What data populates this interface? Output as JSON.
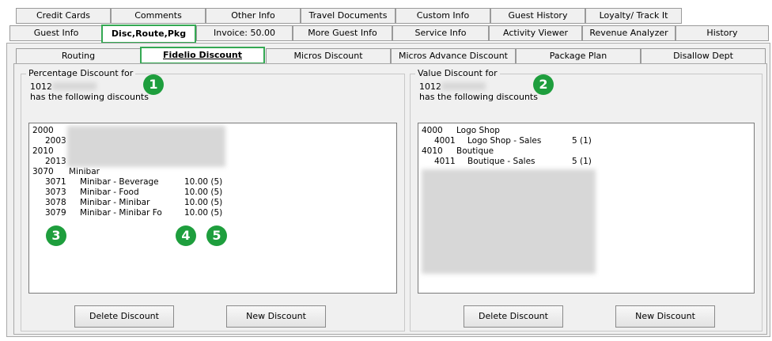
{
  "tabs_row1": [
    "Credit Cards",
    "Comments",
    "Other Info",
    "Travel Documents",
    "Custom Info",
    "Guest History",
    "Loyalty/ Track It"
  ],
  "tabs_row2": [
    "Guest Info",
    "Disc,Route,Pkg",
    "Invoice: 50.00",
    "More Guest Info",
    "Service Info",
    "Activity Viewer",
    "Revenue Analyzer",
    "History"
  ],
  "subtabs": [
    "Routing",
    "Fidelio Discount",
    "Micros Discount",
    "Micros Advance Discount",
    "Package Plan",
    "Disallow Dept"
  ],
  "left_group": {
    "title": "Percentage Discount for",
    "account": "1012",
    "subtitle": "has the following discounts",
    "rows": [
      {
        "code": "2000",
        "name": "",
        "value": ""
      },
      {
        "code": "2003",
        "name": "",
        "value": ""
      },
      {
        "code": "2010",
        "name": "",
        "value": ""
      },
      {
        "code": "2013",
        "name": "",
        "value": ""
      },
      {
        "code": "3070",
        "name": "Minibar",
        "value": ""
      },
      {
        "code": "3071",
        "name": "Minibar - Beverage",
        "value": "10.00 (5)"
      },
      {
        "code": "3073",
        "name": "Minibar - Food",
        "value": "10.00 (5)"
      },
      {
        "code": "3078",
        "name": "Minibar - Minibar",
        "value": "10.00 (5)"
      },
      {
        "code": "3079",
        "name": "Minibar - Minibar Fo",
        "value": "10.00 (5)"
      }
    ],
    "delete_label": "Delete Discount",
    "new_label": "New Discount"
  },
  "right_group": {
    "title": "Value Discount for",
    "account": "1012",
    "subtitle": "has the following discounts",
    "rows": [
      {
        "code": "4000",
        "name": "Logo Shop",
        "value": ""
      },
      {
        "code": "4001",
        "name": "Logo Shop - Sales",
        "value": "5 (1)"
      },
      {
        "code": "4010",
        "name": "Boutique",
        "value": ""
      },
      {
        "code": "4011",
        "name": "Boutique - Sales",
        "value": "5 (1)"
      }
    ],
    "delete_label": "Delete Discount",
    "new_label": "New Discount"
  },
  "badges": [
    "1",
    "2",
    "3",
    "4",
    "5"
  ],
  "colors": {
    "accent_green": "#34a853",
    "badge_green": "#1e9e3d"
  }
}
